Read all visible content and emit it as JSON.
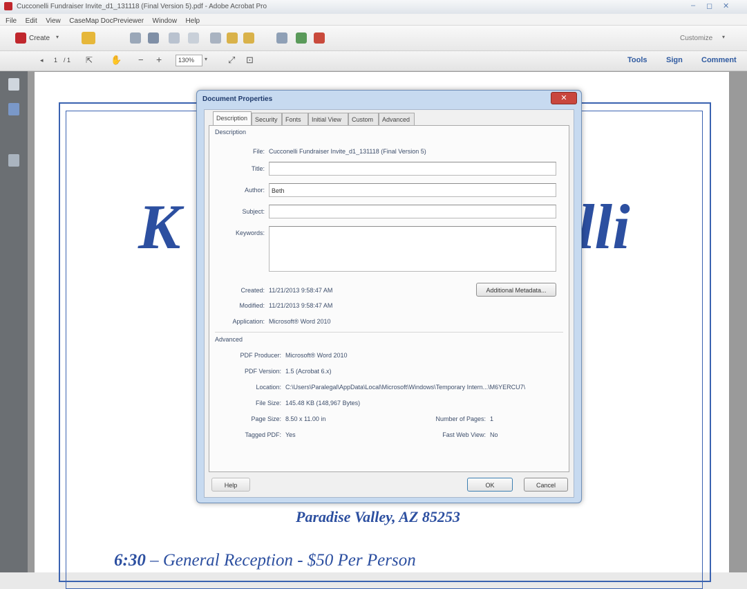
{
  "window": {
    "title": "Cucconelli Fundraiser Invite_d1_131118 (Final Version 5).pdf - Adobe Acrobat Pro",
    "controls": [
      "–",
      "◻",
      "✕"
    ]
  },
  "menubar": [
    "File",
    "Edit",
    "View",
    "CaseMap DocPreviewer",
    "Window",
    "Help"
  ],
  "toolbar": {
    "create_label": "Create",
    "customize_label": "Customize",
    "page_current": "1",
    "page_total": "/ 1",
    "zoom": "130%",
    "right_links": [
      "Tools",
      "Sign",
      "Comment"
    ]
  },
  "document": {
    "heading_left": "K",
    "heading_right": "lli",
    "address": "Paradise Valley, AZ 85253",
    "reception_time": "6:30",
    "reception_text": " – General Reception - $50 Per Person"
  },
  "dialog": {
    "title": "Document Properties",
    "close_glyph": "✕",
    "tabs": [
      "Description",
      "Security",
      "Fonts",
      "Initial View",
      "Custom",
      "Advanced"
    ],
    "description_section": "Description",
    "labels": {
      "file": "File:",
      "title": "Title:",
      "author": "Author:",
      "subject": "Subject:",
      "keywords": "Keywords:",
      "created": "Created:",
      "modified": "Modified:",
      "application": "Application:"
    },
    "values": {
      "file": "Cucconelli Fundraiser Invite_d1_131118 (Final Version 5)",
      "title": "",
      "author": "Beth",
      "subject": "",
      "keywords": "",
      "created": "11/21/2013 9:58:47 AM",
      "modified": "11/21/2013 9:58:47 AM",
      "application": "Microsoft® Word 2010"
    },
    "additional_metadata_button": "Additional Metadata...",
    "advanced_section": "Advanced",
    "advanced": {
      "pdf_producer_label": "PDF Producer:",
      "pdf_producer": "Microsoft® Word 2010",
      "pdf_version_label": "PDF Version:",
      "pdf_version": "1.5 (Acrobat 6.x)",
      "location_label": "Location:",
      "location": "C:\\Users\\Paralegal\\AppData\\Local\\Microsoft\\Windows\\Temporary Intern...\\M6YERCU7\\",
      "file_size_label": "File Size:",
      "file_size": "145.48 KB (148,967 Bytes)",
      "page_size_label": "Page Size:",
      "page_size": "8.50 x 11.00 in",
      "num_pages_label": "Number of Pages:",
      "num_pages": "1",
      "tagged_label": "Tagged PDF:",
      "tagged": "Yes",
      "fast_web_label": "Fast Web View:",
      "fast_web": "No"
    },
    "help_button": "Help",
    "ok_button": "OK",
    "cancel_button": "Cancel"
  }
}
